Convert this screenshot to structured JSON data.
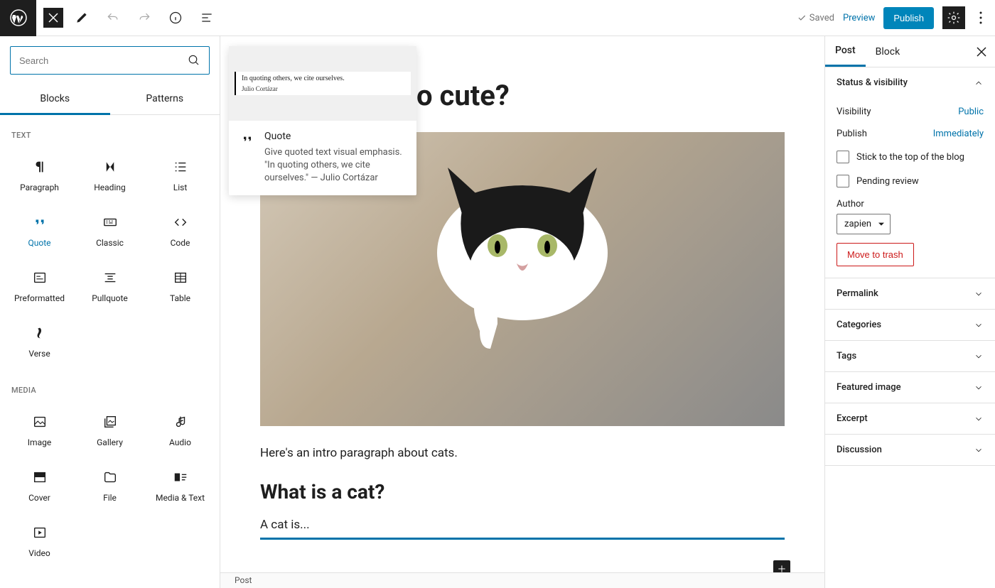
{
  "topbar": {
    "saved": "Saved",
    "preview": "Preview",
    "publish": "Publish"
  },
  "inserter": {
    "search_placeholder": "Search",
    "tabs": [
      "Blocks",
      "Patterns"
    ],
    "categories": {
      "text": {
        "label": "TEXT",
        "blocks": [
          "Paragraph",
          "Heading",
          "List",
          "Quote",
          "Classic",
          "Code",
          "Preformatted",
          "Pullquote",
          "Table",
          "Verse"
        ]
      },
      "media": {
        "label": "MEDIA",
        "blocks": [
          "Image",
          "Gallery",
          "Audio",
          "Cover",
          "File",
          "Media & Text",
          "Video"
        ]
      }
    }
  },
  "quote_popover": {
    "preview_text": "In quoting others, we cite ourselves.",
    "preview_cite": "Julio Cortázar",
    "title": "Quote",
    "description": "Give quoted text visual emphasis. \"In quoting others, we cite ourselves.\" — Julio Cortázar"
  },
  "post": {
    "title_fragment": "o cute?",
    "intro": "Here's an intro paragraph about cats.",
    "h2": "What is a cat?",
    "selected_text": "A cat is..."
  },
  "sidebar": {
    "tabs": [
      "Post",
      "Block"
    ],
    "status": {
      "header": "Status & visibility",
      "visibility_label": "Visibility",
      "visibility_value": "Public",
      "publish_label": "Publish",
      "publish_value": "Immediately",
      "stick": "Stick to the top of the blog",
      "pending": "Pending review",
      "author_label": "Author",
      "author_value": "zapien",
      "trash": "Move to trash"
    },
    "panels": [
      "Permalink",
      "Categories",
      "Tags",
      "Featured image",
      "Excerpt",
      "Discussion"
    ]
  },
  "breadcrumb": "Post"
}
